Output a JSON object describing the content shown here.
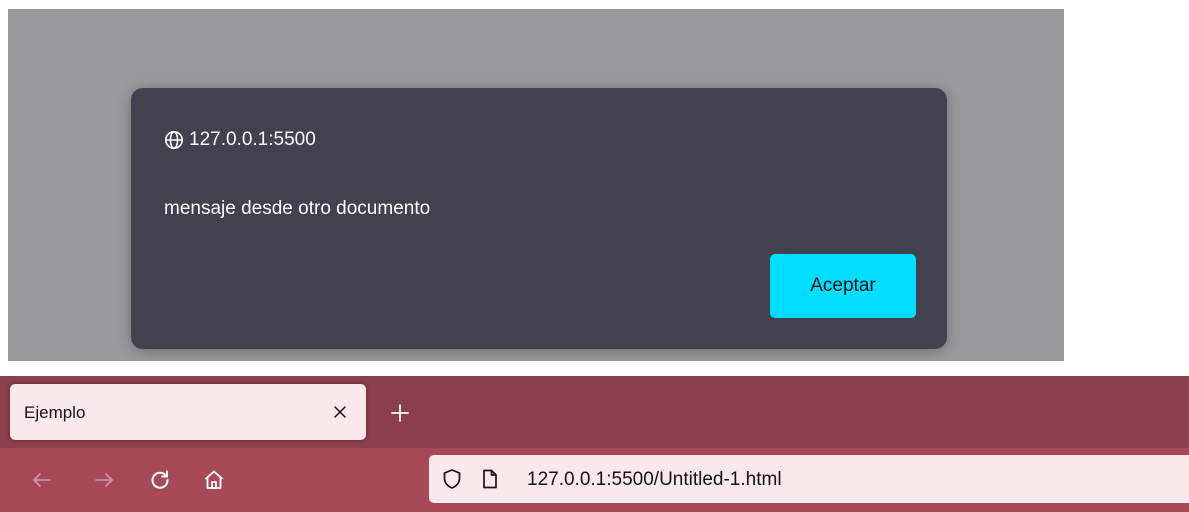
{
  "dialog": {
    "origin": "127.0.0.1:5500",
    "message": "mensaje desde otro documento",
    "accept_label": "Aceptar",
    "origin_icon": "globe-icon",
    "accept_color": "#00ddff",
    "background_color": "#42414d"
  },
  "overlay": {
    "color": "#9a9a9c"
  },
  "browser": {
    "tab": {
      "title": "Ejemplo",
      "close_icon": "close-icon"
    },
    "new_tab_icon": "plus-icon",
    "nav": {
      "back_icon": "back-arrow-icon",
      "forward_icon": "forward-arrow-icon",
      "reload_icon": "reload-icon",
      "home_icon": "home-icon"
    },
    "urlbar": {
      "url": "127.0.0.1:5500/Untitled-1.html",
      "security_icon": "shield-icon",
      "page_icon": "page-icon"
    },
    "theme": {
      "tabstrip_color": "#8b3e4b",
      "toolbar_color": "#a74a57",
      "tab_color": "#f9e8ec"
    }
  }
}
